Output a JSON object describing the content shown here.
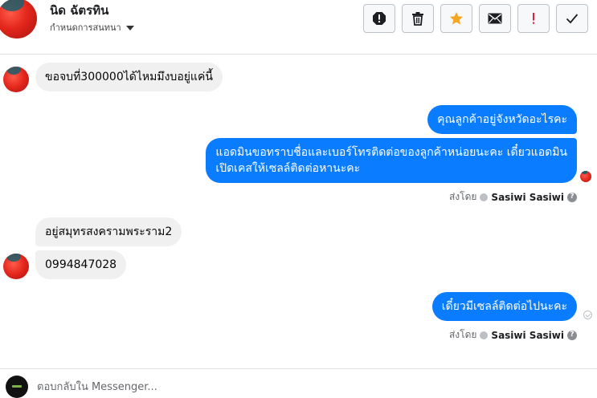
{
  "header": {
    "contact_name": "นิด ฉัตรทิน",
    "assign_label": "กำหนดการสนทนา",
    "actions": [
      {
        "name": "report-spam-icon",
        "label": "!"
      },
      {
        "name": "delete-icon"
      },
      {
        "name": "star-icon",
        "color": "#f5a623"
      },
      {
        "name": "mark-unread-icon"
      },
      {
        "name": "important-icon",
        "label": "!",
        "color": "#e41e3f"
      },
      {
        "name": "done-checkmark-icon"
      }
    ]
  },
  "messages": [
    {
      "direction": "in",
      "text": "ขอจบที่300000ได้ไหมมึงบอยู่แค่นี้"
    },
    {
      "direction": "out",
      "text": "คุณลูกค้าอยู่จังหวัดอะไรคะ"
    },
    {
      "direction": "out",
      "lines": [
        "แอดมินขอทราบชื่อและเบอร์โทรติดต่อของลูกค้าหน่อยนะคะ เดี๋ยวแอดมิน",
        "เปิดเคสให้เซลล์ติดต่อหานะคะ"
      ]
    },
    {
      "direction": "in",
      "text": "อยู่สมุทรสงครามพระราม2"
    },
    {
      "direction": "in",
      "text": "0994847028"
    },
    {
      "direction": "out",
      "text": "เดี๋ยวมีเซลล์ติดต่อไปนะคะ"
    }
  ],
  "sent_by": {
    "prefix": "ส่งโดย",
    "name": "Sasiwi Sasiwi",
    "help": "?"
  },
  "composer": {
    "placeholder": "ตอบกลับใน Messenger..."
  },
  "colors": {
    "outgoing_bubble": "#0a7cff",
    "incoming_bubble": "#f0f0f0",
    "star": "#f5a623",
    "important": "#e41e3f"
  }
}
